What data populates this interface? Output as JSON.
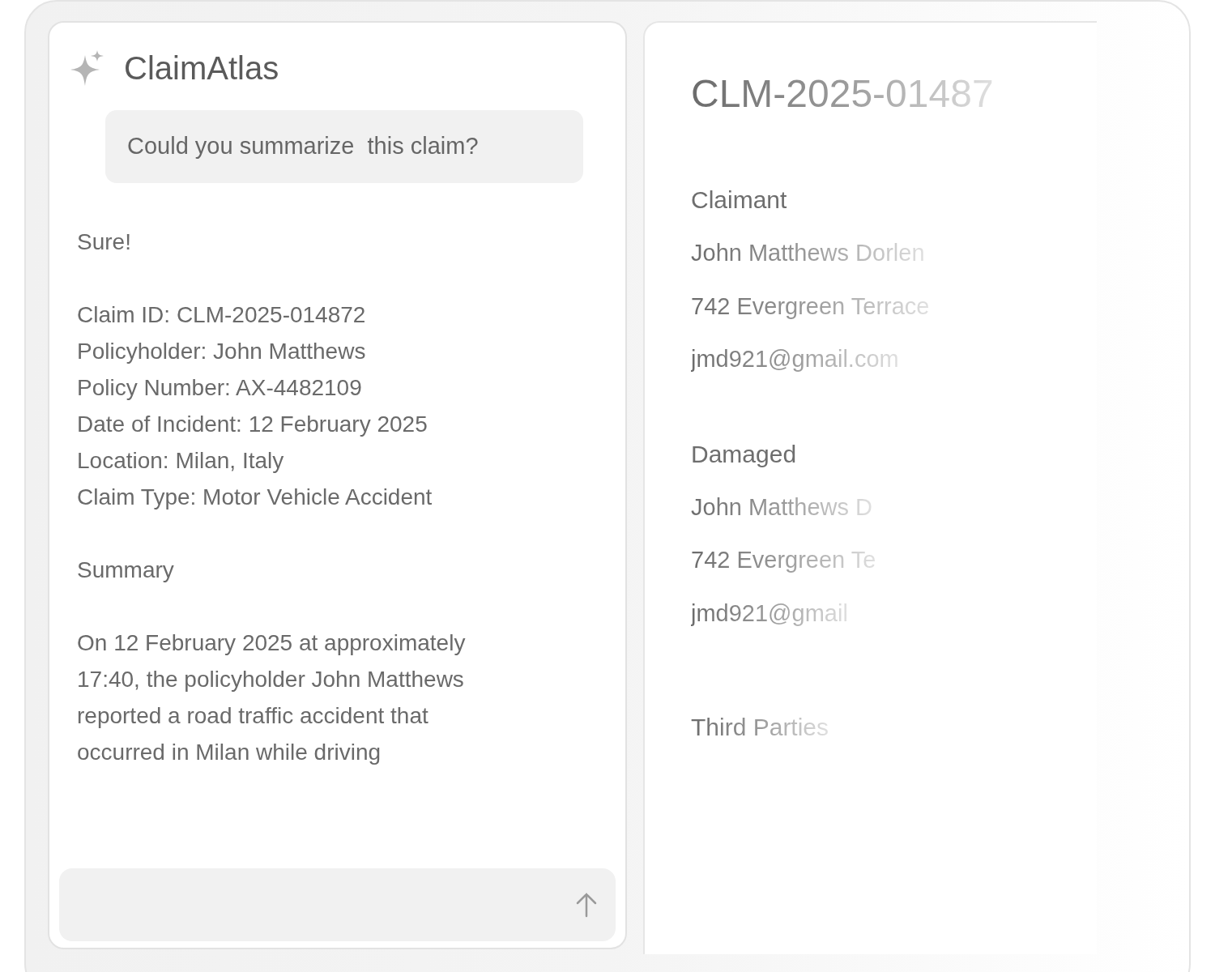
{
  "chat": {
    "brand": "ClaimAtlas",
    "user_message": "Could you summarize  this claim?",
    "reply": {
      "greeting": "Sure!",
      "fields": [
        "Claim ID: CLM-2025-014872",
        "Policyholder: John Matthews",
        "Policy Number: AX-4482109",
        "Date of Incident: 12 February 2025",
        "Location: Milan, Italy",
        "Claim Type: Motor Vehicle Accident"
      ],
      "summary_heading": "Summary",
      "summary_text": "On 12 February 2025 at approximately 17:40, the policyholder John Matthews reported a road traffic accident that occurred in Milan while driving"
    }
  },
  "claim": {
    "id": "CLM-2025-01487",
    "sections": [
      {
        "title": "Claimant",
        "lines": [
          "John Matthews Dorlen",
          "742 Evergreen Terrace",
          "jmd921@gmail.com"
        ]
      },
      {
        "title": "Damaged",
        "lines": [
          "John Matthews D",
          "742 Evergreen Te",
          "jmd921@gmail"
        ]
      },
      {
        "title": "Third Parties"
      }
    ]
  }
}
